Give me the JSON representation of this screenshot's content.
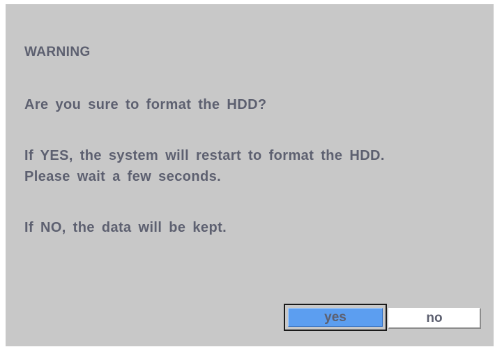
{
  "dialog": {
    "title": "WARNING",
    "question": "Are you sure to format the HDD?",
    "yes_line1": "If YES, the system will restart to format the HDD.",
    "yes_line2": "Please wait a few seconds.",
    "no_line": "If NO, the data will be kept.",
    "yes_label": "yes",
    "no_label": "no",
    "selected_button": "yes"
  },
  "colors": {
    "background": "#c8c8c8",
    "text": "#5d6070",
    "selected_button": "#5c9ef0",
    "unselected_button": "#ffffff"
  }
}
